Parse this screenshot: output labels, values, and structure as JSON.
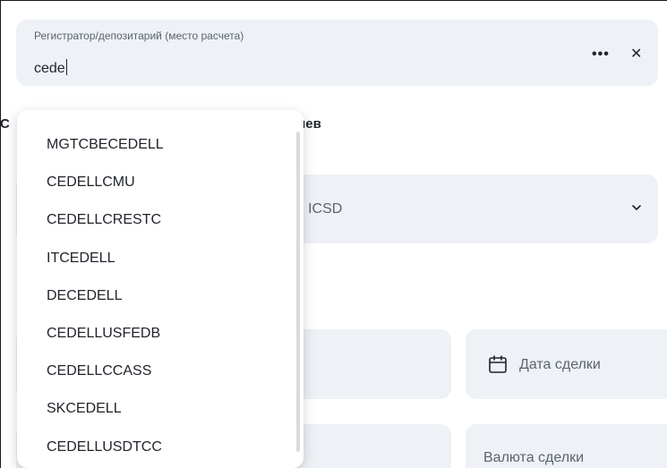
{
  "search": {
    "label": "Регистратор/депозитарий (место расчета)",
    "value": "cede",
    "more_icon": "more-dots-icon",
    "clear_icon": "close-icon"
  },
  "section": {
    "heading_lead": "С",
    "heading_tail": "иев"
  },
  "icsd_select": {
    "visible_text": "я ICSD",
    "icon": "chevron-down-icon"
  },
  "trade_date": {
    "label": "Дата сделки",
    "icon": "calendar-icon"
  },
  "currency": {
    "label": "Валюта сделки"
  },
  "dropdown": {
    "items": [
      "MGTCBECEDELL",
      "CEDELLCMU",
      "CEDELLCRESTC",
      "ITCEDELL",
      "DECEDELL",
      "CEDELLUSFEDB",
      "CEDELLCCASS",
      "SKCEDELL",
      "CEDELLUSDTCC"
    ]
  },
  "colors": {
    "field_background": "#eef1f5",
    "text_primary": "#1f2329",
    "text_secondary": "#5b6470"
  }
}
